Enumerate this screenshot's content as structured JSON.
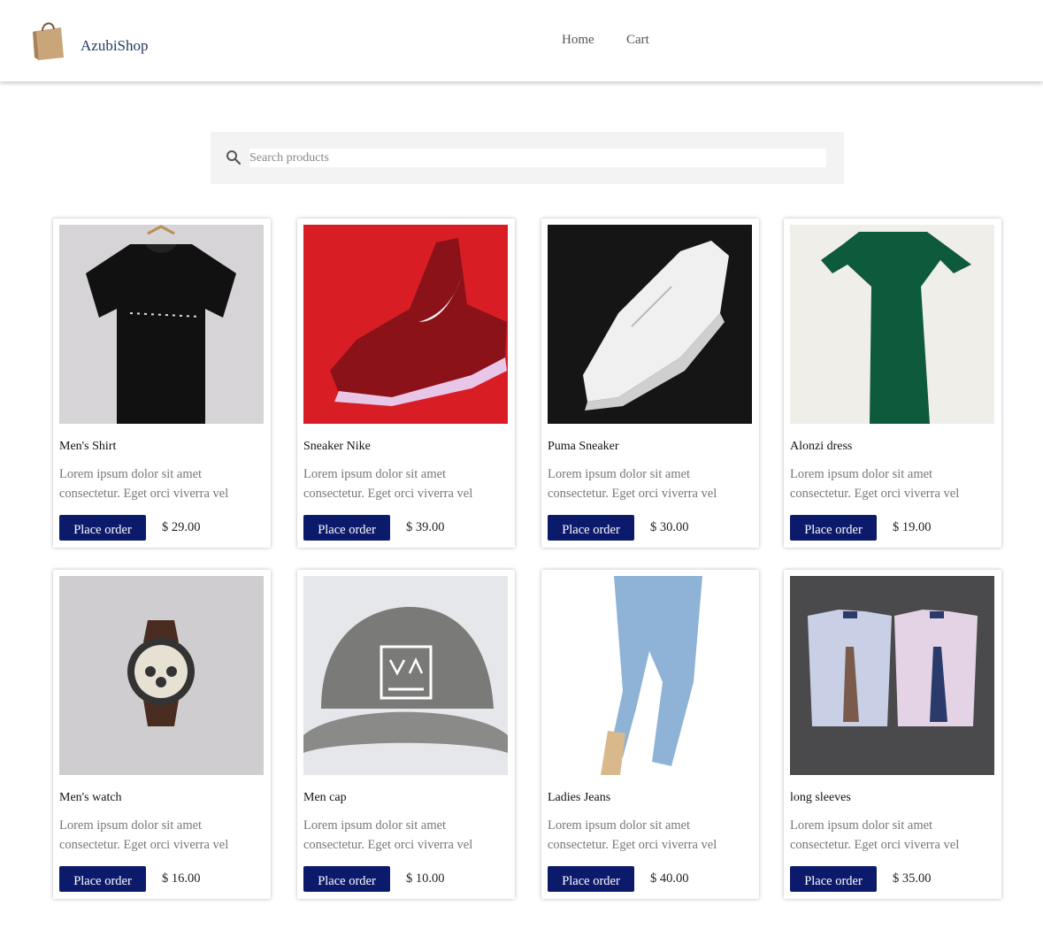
{
  "header": {
    "brand": "AzubiShop",
    "nav": {
      "home": "Home",
      "cart": "Cart"
    }
  },
  "search": {
    "placeholder": "Search products",
    "value": ""
  },
  "products": [
    {
      "title": "Men's Shirt",
      "desc": "Lorem ipsum dolor sit amet consectetur. Eget orci viverra vel",
      "button": "Place order",
      "price": "$ 29.00",
      "image": "black-tshirt-image"
    },
    {
      "title": "Sneaker Nike",
      "desc": "Lorem ipsum dolor sit amet consectetur. Eget orci viverra vel",
      "button": "Place order",
      "price": "$ 39.00",
      "image": "red-nike-sneaker-image"
    },
    {
      "title": "Puma Sneaker",
      "desc": "Lorem ipsum dolor sit amet consectetur. Eget orci viverra vel",
      "button": "Place order",
      "price": "$ 30.00",
      "image": "white-puma-sneaker-image"
    },
    {
      "title": "Alonzi dress",
      "desc": "Lorem ipsum dolor sit amet consectetur. Eget orci viverra vel",
      "button": "Place order",
      "price": "$ 19.00",
      "image": "green-dress-image"
    },
    {
      "title": "Men's watch",
      "desc": "Lorem ipsum dolor sit amet consectetur. Eget orci viverra vel",
      "button": "Place order",
      "price": "$ 16.00",
      "image": "wrist-watch-image"
    },
    {
      "title": "Men cap",
      "desc": "Lorem ipsum dolor sit amet consectetur. Eget orci viverra vel",
      "button": "Place order",
      "price": "$ 10.00",
      "image": "grey-cap-image"
    },
    {
      "title": "Ladies Jeans",
      "desc": "Lorem ipsum dolor sit amet consectetur. Eget orci viverra vel",
      "button": "Place order",
      "price": "$ 40.00",
      "image": "blue-jeans-image"
    },
    {
      "title": "long sleeves",
      "desc": "Lorem ipsum dolor sit amet consectetur. Eget orci viverra vel",
      "button": "Place order",
      "price": "$ 35.00",
      "image": "dress-shirts-image"
    }
  ],
  "colors": {
    "button_bg": "#0c1a6b",
    "brand_text": "#1f3a5f",
    "search_bg": "#f3f3f3"
  }
}
